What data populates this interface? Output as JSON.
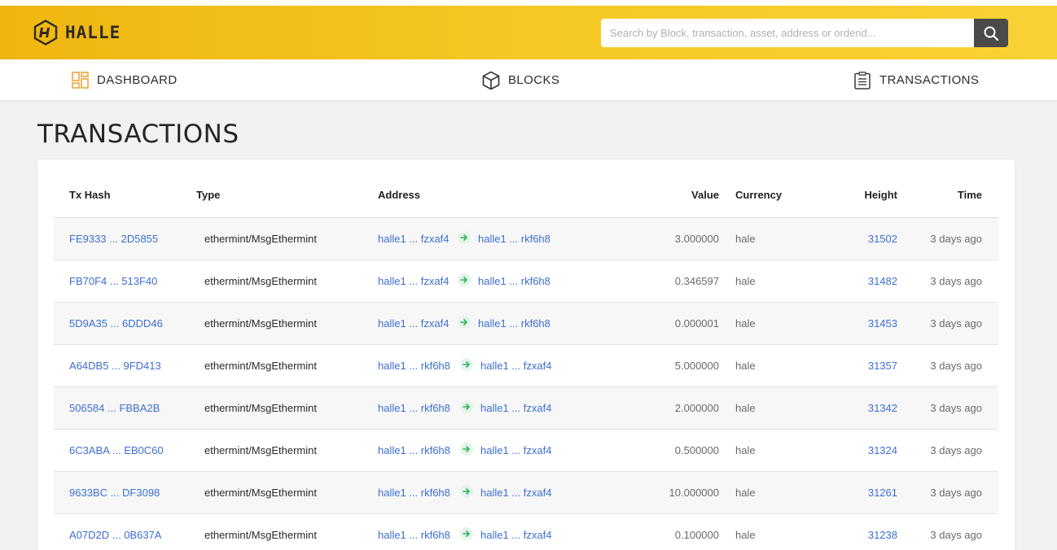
{
  "brand": {
    "name": "HALLE",
    "logo_icon": "halle-hexagon-logo"
  },
  "search": {
    "placeholder": "Search by Block, transaction, asset, address or orderid...",
    "value": "",
    "button_icon": "search-icon"
  },
  "nav": {
    "items": [
      {
        "label": "DASHBOARD",
        "icon": "dashboard-icon",
        "active": true
      },
      {
        "label": "BLOCKS",
        "icon": "cube-icon",
        "active": false
      },
      {
        "label": "TRANSACTIONS",
        "icon": "clipboard-list-icon",
        "active": false
      }
    ]
  },
  "page": {
    "title": "TRANSACTIONS"
  },
  "table": {
    "headers": {
      "tx_hash": "Tx Hash",
      "type": "Type",
      "address": "Address",
      "value": "Value",
      "currency": "Currency",
      "height": "Height",
      "time": "Time"
    },
    "rows": [
      {
        "tx_hash": "FE9333 ... 2D5855",
        "type": "ethermint/MsgEthermint",
        "from": "halle1 ... fzxaf4",
        "to": "halle1 ... rkf6h8",
        "value": "3.000000",
        "currency": "hale",
        "height": "31502",
        "time": "3 days ago"
      },
      {
        "tx_hash": "FB70F4 ... 513F40",
        "type": "ethermint/MsgEthermint",
        "from": "halle1 ... fzxaf4",
        "to": "halle1 ... rkf6h8",
        "value": "0.346597",
        "currency": "hale",
        "height": "31482",
        "time": "3 days ago"
      },
      {
        "tx_hash": "5D9A35 ... 6DDD46",
        "type": "ethermint/MsgEthermint",
        "from": "halle1 ... fzxaf4",
        "to": "halle1 ... rkf6h8",
        "value": "0.000001",
        "currency": "hale",
        "height": "31453",
        "time": "3 days ago"
      },
      {
        "tx_hash": "A64DB5 ... 9FD413",
        "type": "ethermint/MsgEthermint",
        "from": "halle1 ... rkf6h8",
        "to": "halle1 ... fzxaf4",
        "value": "5.000000",
        "currency": "hale",
        "height": "31357",
        "time": "3 days ago"
      },
      {
        "tx_hash": "506584 ... FBBA2B",
        "type": "ethermint/MsgEthermint",
        "from": "halle1 ... rkf6h8",
        "to": "halle1 ... fzxaf4",
        "value": "2.000000",
        "currency": "hale",
        "height": "31342",
        "time": "3 days ago"
      },
      {
        "tx_hash": "6C3ABA ... EB0C60",
        "type": "ethermint/MsgEthermint",
        "from": "halle1 ... rkf6h8",
        "to": "halle1 ... fzxaf4",
        "value": "0.500000",
        "currency": "hale",
        "height": "31324",
        "time": "3 days ago"
      },
      {
        "tx_hash": "9633BC ... DF3098",
        "type": "ethermint/MsgEthermint",
        "from": "halle1 ... rkf6h8",
        "to": "halle1 ... fzxaf4",
        "value": "10.000000",
        "currency": "hale",
        "height": "31261",
        "time": "3 days ago"
      },
      {
        "tx_hash": "A07D2D ... 0B637A",
        "type": "ethermint/MsgEthermint",
        "from": "halle1 ... rkf6h8",
        "to": "halle1 ... fzxaf4",
        "value": "0.100000",
        "currency": "hale",
        "height": "31238",
        "time": "3 days ago"
      }
    ]
  },
  "colors": {
    "header_yellow": "#f5c823",
    "link_blue": "#3d6fd1",
    "accent_orange": "#f0a43a",
    "arrow_green": "#2fb35a"
  }
}
